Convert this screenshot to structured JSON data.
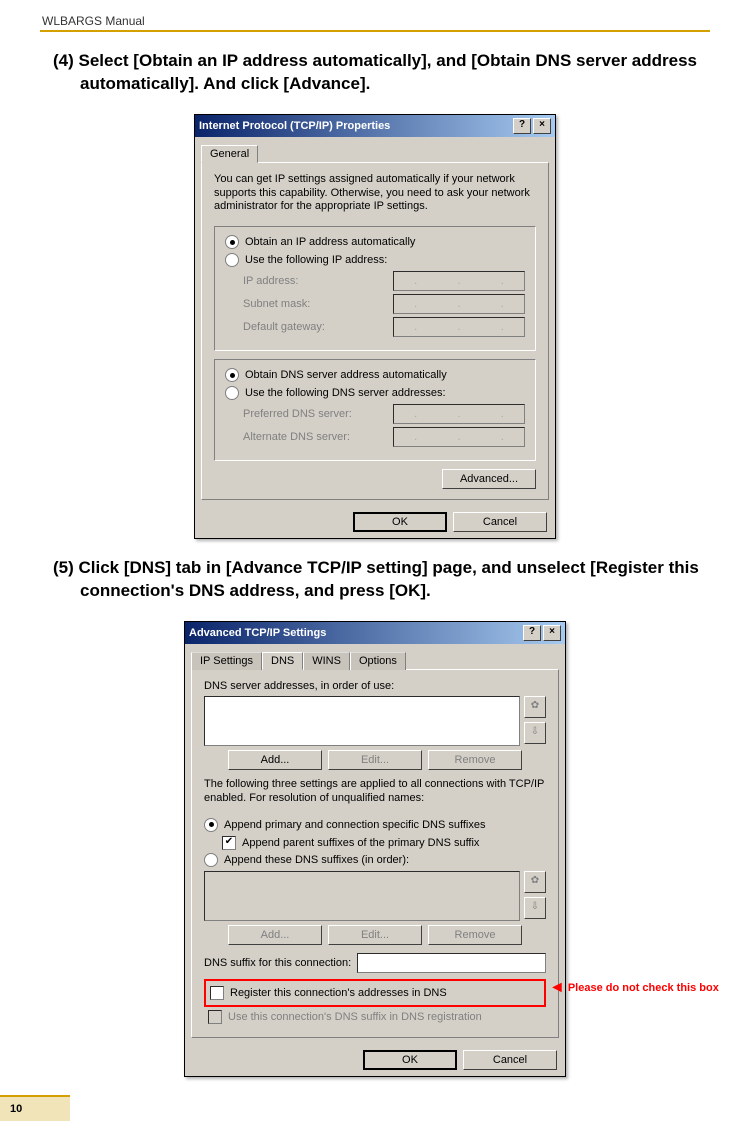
{
  "header": "WLBARGS Manual",
  "step4": "(4) Select [Obtain an IP address automatically], and [Obtain DNS server address automatically]. And click [Advance].",
  "step5": "(5) Click [DNS] tab in [Advance TCP/IP setting] page, and unselect [Register this connection's DNS address, and press [OK].",
  "d1": {
    "title": "Internet Protocol (TCP/IP) Properties",
    "tab": "General",
    "intro": "You can get IP settings assigned automatically if your network supports this capability. Otherwise, you need to ask your network administrator for the appropriate IP settings.",
    "r1": "Obtain an IP address automatically",
    "r2": "Use the following IP address:",
    "f1": "IP address:",
    "f2": "Subnet mask:",
    "f3": "Default gateway:",
    "r3": "Obtain DNS server address automatically",
    "r4": "Use the following DNS server addresses:",
    "f4": "Preferred DNS server:",
    "f5": "Alternate DNS server:",
    "adv": "Advanced...",
    "ok": "OK",
    "cancel": "Cancel"
  },
  "d2": {
    "title": "Advanced TCP/IP Settings",
    "t1": "IP Settings",
    "t2": "DNS",
    "t3": "WINS",
    "t4": "Options",
    "lbl1": "DNS server addresses, in order of use:",
    "add": "Add...",
    "edit": "Edit...",
    "remove": "Remove",
    "intro": "The following three settings are applied to all connections with TCP/IP enabled. For resolution of unqualified names:",
    "r1": "Append primary and connection specific DNS suffixes",
    "c1": "Append parent suffixes of the primary DNS suffix",
    "r2": "Append these DNS suffixes (in order):",
    "lbl2": "DNS suffix for this connection:",
    "c2": "Register this connection's addresses in DNS",
    "c3": "Use this connection's DNS suffix in DNS registration",
    "anno": "Please do not check this box",
    "ok": "OK",
    "cancel": "Cancel"
  },
  "pgnum": "10"
}
